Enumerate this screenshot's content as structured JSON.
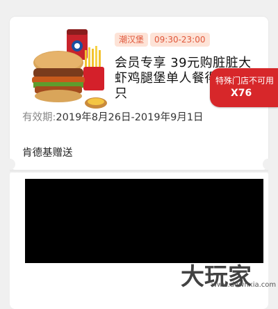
{
  "coupon": {
    "tag_category": "潮汉堡",
    "tag_time": "09:30-23:00",
    "title": "会员专享 39元购脏脏大虾鸡腿堡单人餐得蛋挞1只",
    "validity_label": "有效期:",
    "validity_value": "2019年8月26日-2019年9月1日",
    "giver": "肯德基赠送",
    "badge_line1": "特殊门店不可用",
    "badge_line2": "X76"
  },
  "watermark": {
    "text": "大玩家",
    "url": "www.downxia.com"
  },
  "colors": {
    "accent": "#d7272a",
    "tag_bg": "#fde3d7",
    "tag_text": "#e0573b"
  }
}
